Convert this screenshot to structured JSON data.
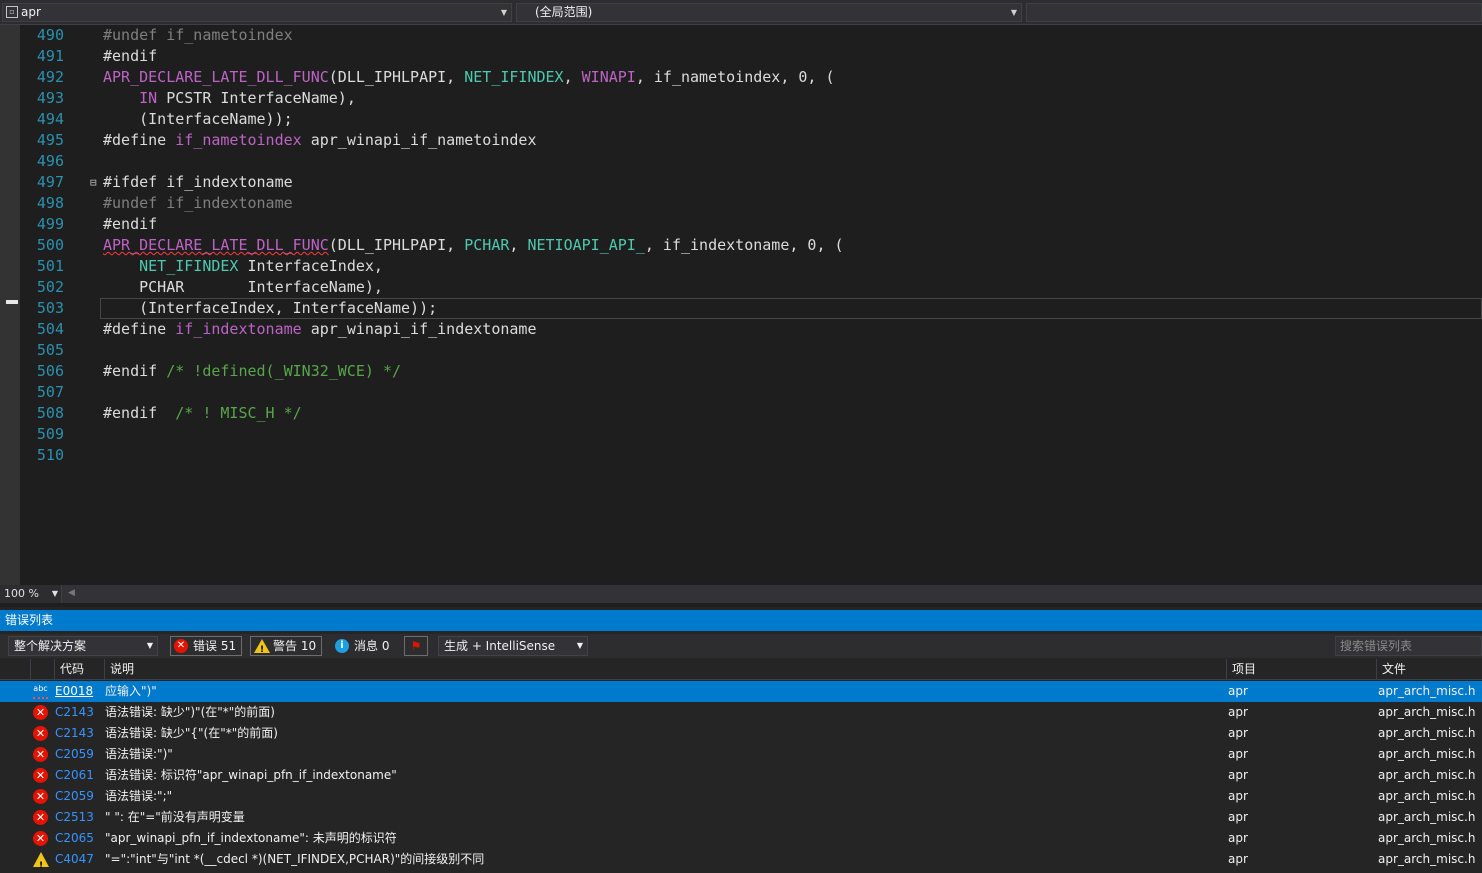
{
  "nav": {
    "project": "apr",
    "scope": "(全局范围)"
  },
  "editor": {
    "zoom": "100 %",
    "lines": [
      {
        "num": "490",
        "tokens": [
          [
            "dim",
            "#undef "
          ],
          [
            "dim",
            "if_nametoindex"
          ]
        ]
      },
      {
        "num": "491",
        "tokens": [
          [
            "def",
            "#endif"
          ]
        ]
      },
      {
        "num": "492",
        "tokens": [
          [
            "mac",
            "APR_DECLARE_LATE_DLL_FUNC"
          ],
          [
            "def",
            "(DLL_IPHLPAPI, "
          ],
          [
            "typ",
            "NET_IFINDEX"
          ],
          [
            "def",
            ", "
          ],
          [
            "mac",
            "WINAPI"
          ],
          [
            "def",
            ", if_nametoindex, 0, ("
          ]
        ]
      },
      {
        "num": "493",
        "tokens": [
          [
            "def",
            "    "
          ],
          [
            "mac",
            "IN"
          ],
          [
            "def",
            " PCSTR InterfaceName),"
          ]
        ]
      },
      {
        "num": "494",
        "tokens": [
          [
            "def",
            "    (InterfaceName));"
          ]
        ]
      },
      {
        "num": "495",
        "tokens": [
          [
            "def",
            "#define "
          ],
          [
            "mac",
            "if_nametoindex"
          ],
          [
            "def",
            " apr_winapi_if_nametoindex"
          ]
        ]
      },
      {
        "num": "496",
        "tokens": []
      },
      {
        "num": "497",
        "tokens": [
          [
            "def",
            "#ifdef if_indextoname"
          ]
        ],
        "fold": "⊟"
      },
      {
        "num": "498",
        "tokens": [
          [
            "dim",
            "#undef if_indextoname"
          ]
        ]
      },
      {
        "num": "499",
        "tokens": [
          [
            "def",
            "#endif"
          ]
        ]
      },
      {
        "num": "500",
        "tokens": [
          [
            "mac-sq",
            "APR_DECLARE_LATE_DLL_FUNC"
          ],
          [
            "def",
            "(DLL_IPHLPAPI, "
          ],
          [
            "typ",
            "PCHAR"
          ],
          [
            "def",
            ", "
          ],
          [
            "typ",
            "NETIOAPI_API_"
          ],
          [
            "def",
            ", if_indextoname, 0, ("
          ]
        ]
      },
      {
        "num": "501",
        "tokens": [
          [
            "def",
            "    "
          ],
          [
            "typ",
            "NET_IFINDEX"
          ],
          [
            "def",
            " InterfaceIndex,"
          ]
        ]
      },
      {
        "num": "502",
        "tokens": [
          [
            "def",
            "    PCHAR       InterfaceName),"
          ]
        ]
      },
      {
        "num": "503",
        "tokens": [
          [
            "def",
            "    (InterfaceIndex, InterfaceName));"
          ]
        ],
        "current": true
      },
      {
        "num": "504",
        "tokens": [
          [
            "def",
            "#define "
          ],
          [
            "mac",
            "if_indextoname"
          ],
          [
            "def",
            " apr_winapi_if_indextoname"
          ]
        ]
      },
      {
        "num": "505",
        "tokens": []
      },
      {
        "num": "506",
        "tokens": [
          [
            "def",
            "#endif "
          ],
          [
            "cm",
            "/* !defined(_WIN32_WCE) */"
          ]
        ]
      },
      {
        "num": "507",
        "tokens": []
      },
      {
        "num": "508",
        "tokens": [
          [
            "def",
            "#endif  "
          ],
          [
            "cm",
            "/* ! MISC_H */"
          ]
        ]
      },
      {
        "num": "509",
        "tokens": []
      },
      {
        "num": "510",
        "tokens": []
      }
    ]
  },
  "error_list": {
    "title": "错误列表",
    "scope": "整个解决方案",
    "errors_label": "错误 51",
    "warnings_label": "警告 10",
    "messages_label": "消息 0",
    "build_filter": "生成 + IntelliSense",
    "search_placeholder": "搜索错误列表",
    "columns": {
      "code": "代码",
      "desc": "说明",
      "project": "项目",
      "file": "文件"
    },
    "rows": [
      {
        "icon": "abc",
        "code": "E0018",
        "desc": "应输入\")\"",
        "project": "apr",
        "file": "apr_arch_misc.h",
        "selected": true
      },
      {
        "icon": "error",
        "code": "C2143",
        "desc": "语法错误: 缺少\")\"(在\"*\"的前面)",
        "project": "apr",
        "file": "apr_arch_misc.h"
      },
      {
        "icon": "error",
        "code": "C2143",
        "desc": "语法错误: 缺少\"{\"(在\"*\"的前面)",
        "project": "apr",
        "file": "apr_arch_misc.h"
      },
      {
        "icon": "error",
        "code": "C2059",
        "desc": "语法错误:\")\"",
        "project": "apr",
        "file": "apr_arch_misc.h"
      },
      {
        "icon": "error",
        "code": "C2061",
        "desc": "语法错误: 标识符\"apr_winapi_pfn_if_indextoname\"",
        "project": "apr",
        "file": "apr_arch_misc.h"
      },
      {
        "icon": "error",
        "code": "C2059",
        "desc": "语法错误:\";\"",
        "project": "apr",
        "file": "apr_arch_misc.h"
      },
      {
        "icon": "error",
        "code": "C2513",
        "desc": "\" \": 在\"=\"前没有声明变量",
        "project": "apr",
        "file": "apr_arch_misc.h"
      },
      {
        "icon": "error",
        "code": "C2065",
        "desc": "\"apr_winapi_pfn_if_indextoname\": 未声明的标识符",
        "project": "apr",
        "file": "apr_arch_misc.h"
      },
      {
        "icon": "warning",
        "code": "C4047",
        "desc": "\"=\":\"int\"与\"int *(__cdecl *)(NET_IFINDEX,PCHAR)\"的间接级别不同",
        "project": "apr",
        "file": "apr_arch_misc.h"
      }
    ]
  }
}
